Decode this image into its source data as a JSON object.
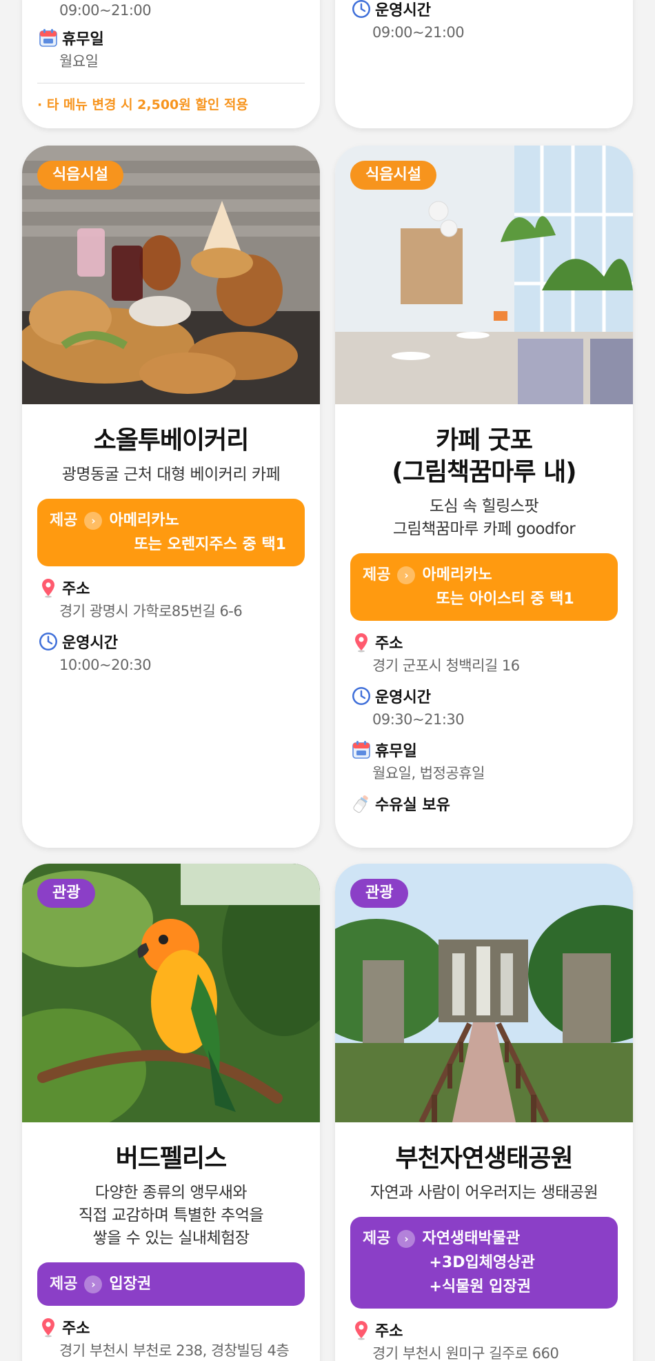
{
  "top_partial": {
    "left": {
      "hours_value": "09:00~21:00",
      "holiday_label": "휴무일",
      "holiday_value": "월요일",
      "note": "· 타 메뉴 변경 시 2,500원 할인 적용"
    },
    "right": {
      "hours_label": "운영시간",
      "hours_value": "09:00~21:00"
    }
  },
  "labels": {
    "provide": "제공",
    "address": "주소",
    "hours": "운영시간",
    "holiday": "휴무일"
  },
  "cards": [
    {
      "tag": "식음시설",
      "title": "소올투베이커리",
      "description": [
        "광명동굴 근처 대형 베이커리 카페"
      ],
      "provide": [
        "아메리카노",
        "또는 오렌지주스 중 택1"
      ],
      "address": "경기 광명시 가학로85번길 6-6",
      "hours": "10:00~20:30"
    },
    {
      "tag": "식음시설",
      "title": [
        "카페 굿포",
        "(그림책꿈마루 내)"
      ],
      "description": [
        "도심 속 힐링스팟",
        "그림책꿈마루 카페 goodfor"
      ],
      "provide": [
        "아메리카노",
        "또는 아이스티 중 택1"
      ],
      "address": "경기 군포시 청백리길 16",
      "hours": "09:30~21:30",
      "holiday": "월요일, 법정공휴일",
      "nursing": "수유실 보유"
    },
    {
      "tag": "관광",
      "title": "버드펠리스",
      "description": [
        "다양한 종류의 앵무새와",
        "직접 교감하며 특별한 추억을",
        "쌓을 수 있는 실내체험장"
      ],
      "provide": [
        "입장권"
      ],
      "address": "경기 부천시 부천로 238, 경창빌딩 4층"
    },
    {
      "tag": "관광",
      "title": "부천자연생태공원",
      "description": [
        "자연과 사람이 어우러지는 생태공원"
      ],
      "provide": [
        "자연생태박물관",
        "+3D입체영상관",
        "+식물원 입장권"
      ],
      "address": "경기 부천시 원미구 길주로 660"
    }
  ],
  "colors": {
    "food_tag": "#f7941d",
    "tour_tag": "#8b3fc7",
    "provide_orange": "#ff9a10",
    "provide_purple": "#8b3fc7"
  },
  "icons": {
    "address": "map-pin-icon",
    "hours": "clock-icon",
    "holiday": "calendar-icon",
    "nursing": "baby-bottle-icon"
  }
}
